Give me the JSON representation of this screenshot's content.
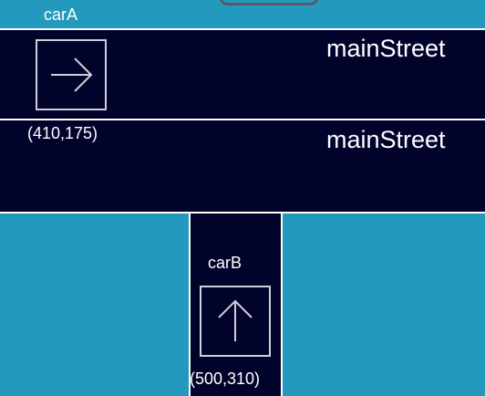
{
  "streets": {
    "upper_label": "mainStreet",
    "lower_label": "mainStreet"
  },
  "cars": {
    "carA": {
      "name": "carA",
      "coords": "(410,175)",
      "direction": "right-arrow-icon"
    },
    "carB": {
      "name": "carB",
      "coords": "(500,310)",
      "direction": "up-arrow-icon"
    }
  },
  "colors": {
    "background": "#2399bd",
    "road": "#02032b",
    "line": "#ffffff",
    "arrow": "#cfcfd6"
  }
}
